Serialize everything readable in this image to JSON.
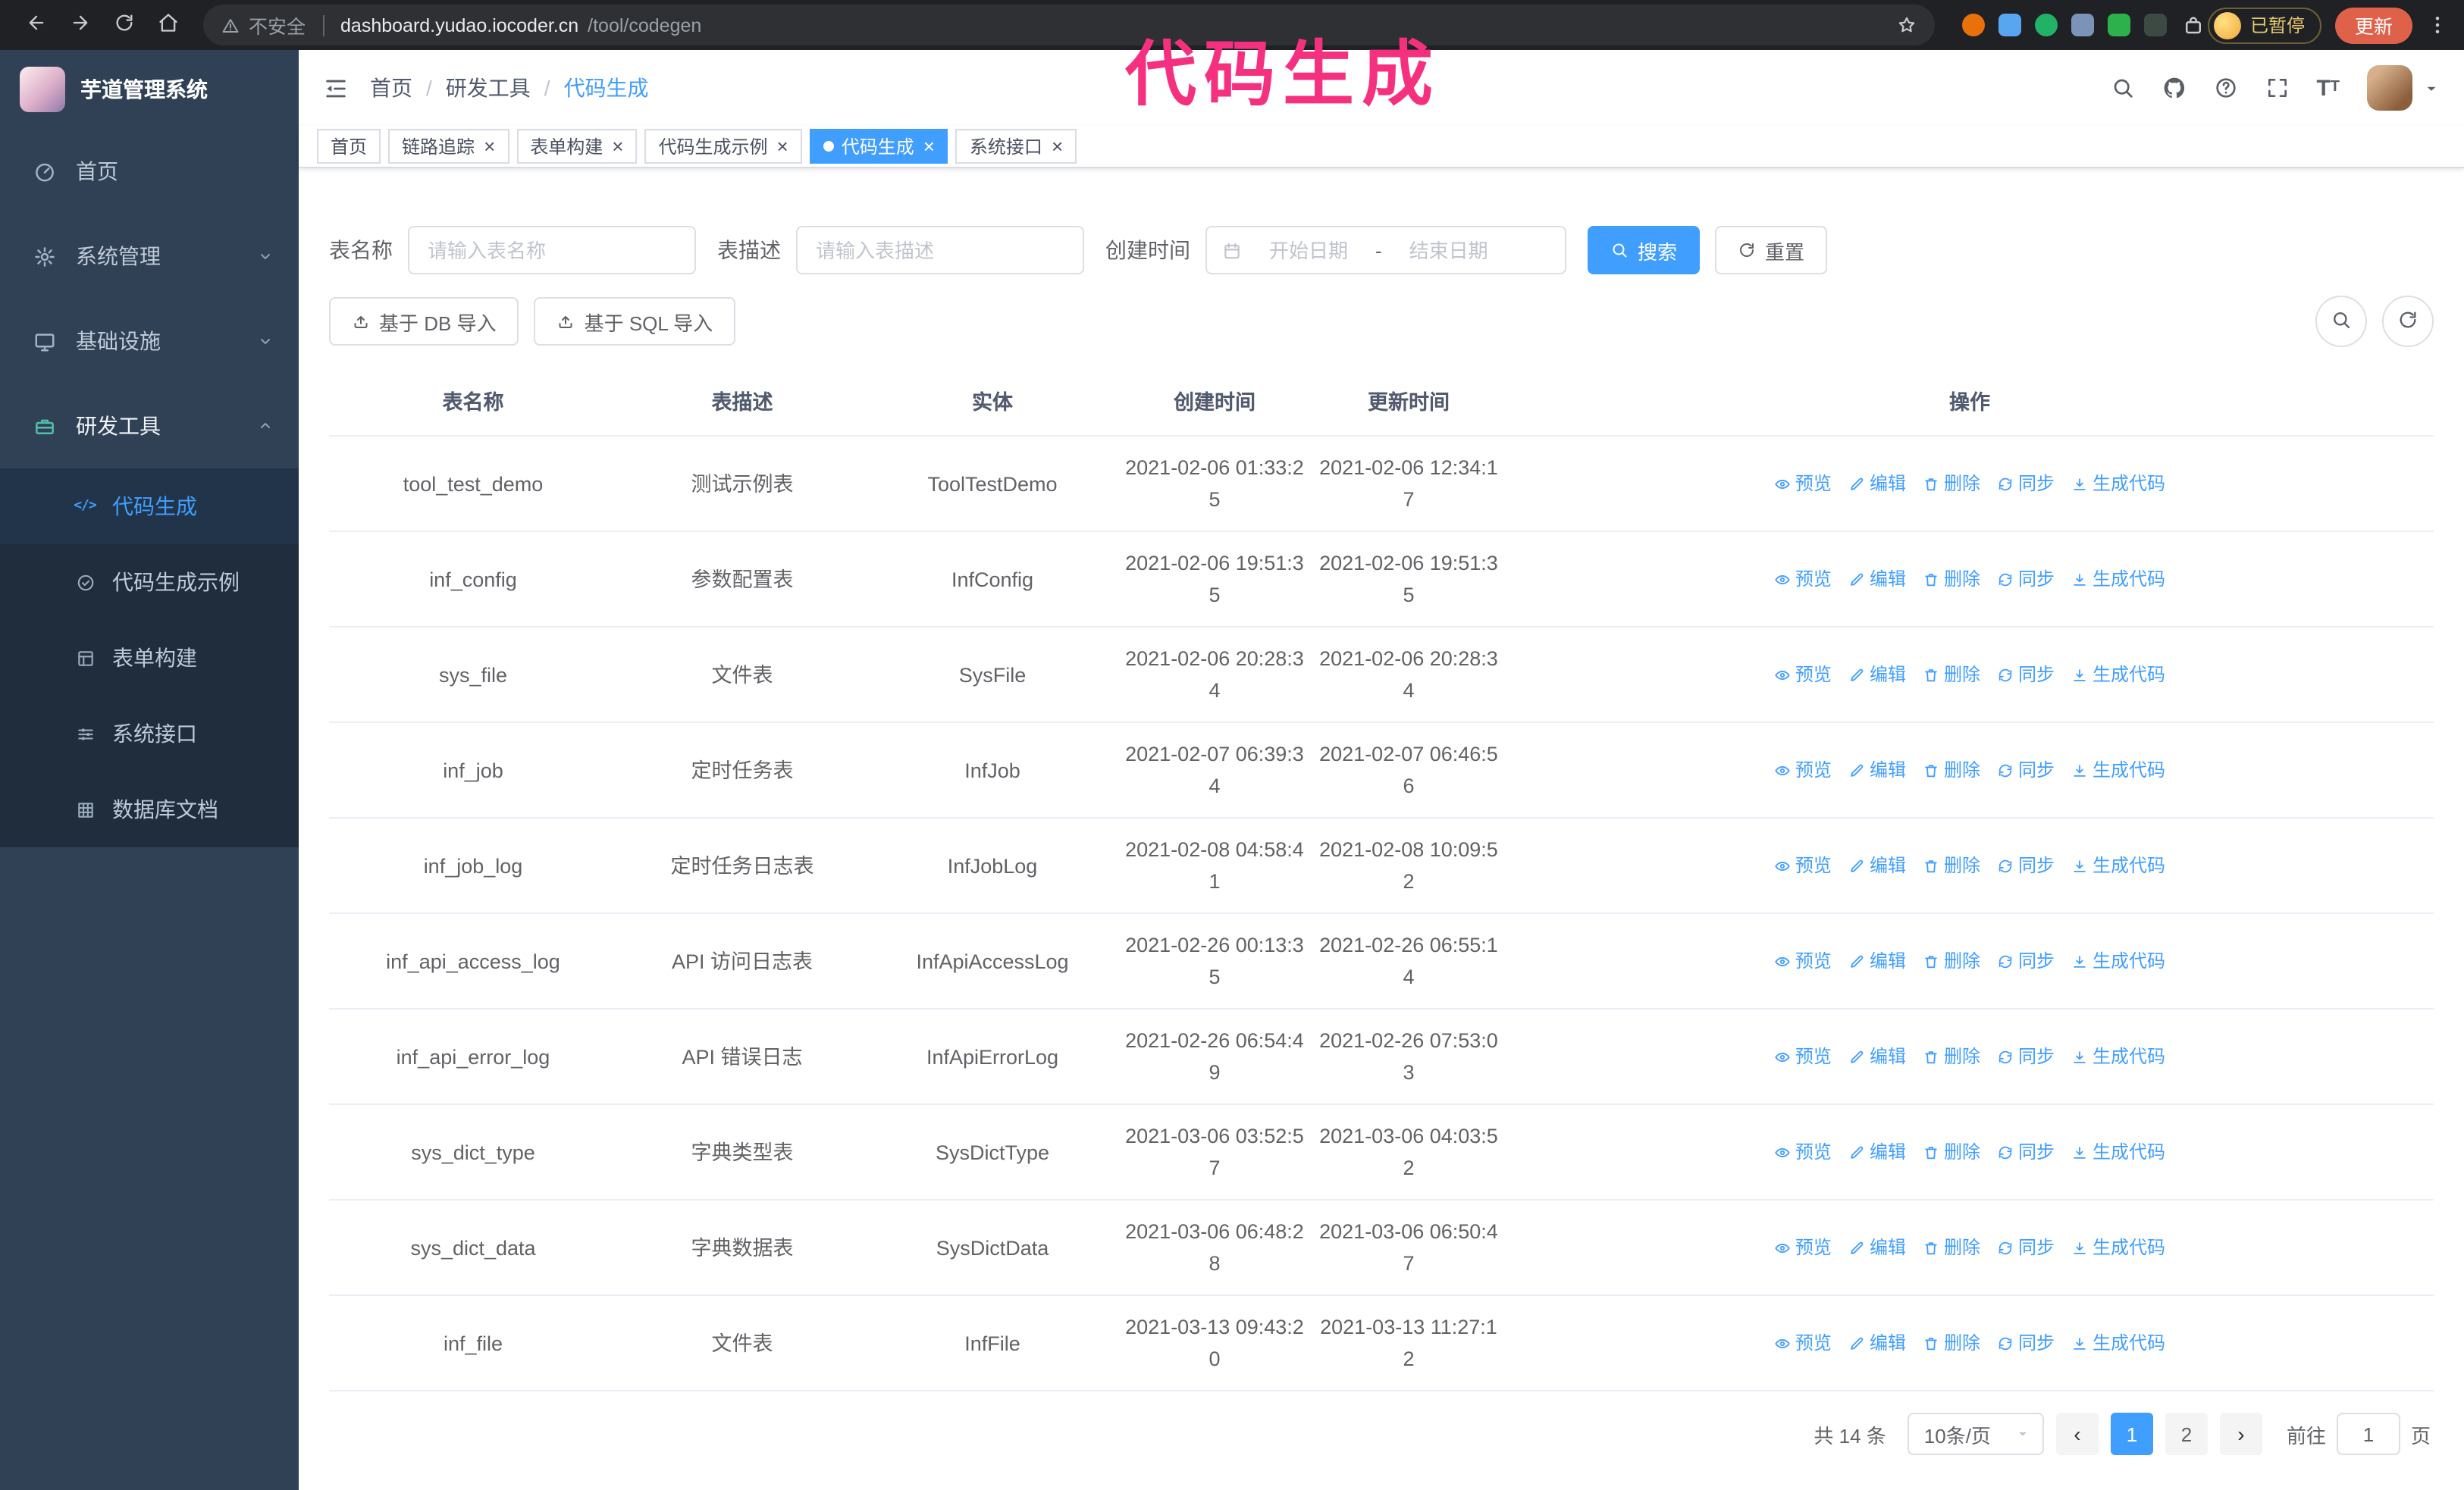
{
  "browser": {
    "security_label": "不安全",
    "url_host": "dashboard.yudao.iocoder.cn",
    "url_path": "/tool/codegen",
    "profile_badge": "已暂停",
    "update_button": "更新",
    "extension_colors": [
      "#e8710a",
      "#58a6f0",
      "#21b267",
      "#7a93b6",
      "#2bb24c",
      "#3d4a44"
    ]
  },
  "annotation": {
    "text": "代码生成",
    "color": "#f5317f"
  },
  "sidebar": {
    "logo_title": "芋道管理系统",
    "items": [
      {
        "label": "首页",
        "icon": "gauge"
      },
      {
        "label": "系统管理",
        "icon": "gear",
        "chevron": "down"
      },
      {
        "label": "基础设施",
        "icon": "monitor",
        "chevron": "down"
      },
      {
        "label": "研发工具",
        "icon": "toolbox",
        "chevron": "up",
        "expanded": true
      }
    ],
    "sub_items": [
      {
        "label": "代码生成",
        "icon": "code",
        "active": true
      },
      {
        "label": "代码生成示例",
        "icon": "badge-check",
        "active": false
      },
      {
        "label": "表单构建",
        "icon": "form-grid",
        "active": false
      },
      {
        "label": "系统接口",
        "icon": "sliders",
        "active": false
      },
      {
        "label": "数据库文档",
        "icon": "table-grid",
        "active": false
      }
    ]
  },
  "header": {
    "breadcrumb": [
      "首页",
      "研发工具",
      "代码生成"
    ]
  },
  "tabs": [
    {
      "label": "首页",
      "closable": false,
      "active": false
    },
    {
      "label": "链路追踪",
      "closable": true,
      "active": false
    },
    {
      "label": "表单构建",
      "closable": true,
      "active": false
    },
    {
      "label": "代码生成示例",
      "closable": true,
      "active": false
    },
    {
      "label": "代码生成",
      "closable": true,
      "active": true
    },
    {
      "label": "系统接口",
      "closable": true,
      "active": false
    }
  ],
  "filters": {
    "table_name_label": "表名称",
    "table_name_placeholder": "请输入表名称",
    "table_desc_label": "表描述",
    "table_desc_placeholder": "请输入表描述",
    "create_time_label": "创建时间",
    "start_date_placeholder": "开始日期",
    "end_date_placeholder": "结束日期",
    "date_separator": "-",
    "search_button": "搜索",
    "reset_button": "重置"
  },
  "toolbar": {
    "import_db": "基于 DB 导入",
    "import_sql": "基于 SQL 导入"
  },
  "table": {
    "columns": [
      "表名称",
      "表描述",
      "实体",
      "创建时间",
      "更新时间",
      "操作"
    ],
    "actions": [
      "预览",
      "编辑",
      "删除",
      "同步",
      "生成代码"
    ],
    "rows": [
      {
        "name": "tool_test_demo",
        "desc": "测试示例表",
        "entity": "ToolTestDemo",
        "created": "2021-02-06 01:33:25",
        "updated": "2021-02-06 12:34:17"
      },
      {
        "name": "inf_config",
        "desc": "参数配置表",
        "entity": "InfConfig",
        "created": "2021-02-06 19:51:35",
        "updated": "2021-02-06 19:51:35"
      },
      {
        "name": "sys_file",
        "desc": "文件表",
        "entity": "SysFile",
        "created": "2021-02-06 20:28:34",
        "updated": "2021-02-06 20:28:34"
      },
      {
        "name": "inf_job",
        "desc": "定时任务表",
        "entity": "InfJob",
        "created": "2021-02-07 06:39:34",
        "updated": "2021-02-07 06:46:56"
      },
      {
        "name": "inf_job_log",
        "desc": "定时任务日志表",
        "entity": "InfJobLog",
        "created": "2021-02-08 04:58:41",
        "updated": "2021-02-08 10:09:52"
      },
      {
        "name": "inf_api_access_log",
        "desc": "API 访问日志表",
        "entity": "InfApiAccessLog",
        "created": "2021-02-26 00:13:35",
        "updated": "2021-02-26 06:55:14"
      },
      {
        "name": "inf_api_error_log",
        "desc": "API 错误日志",
        "entity": "InfApiErrorLog",
        "created": "2021-02-26 06:54:49",
        "updated": "2021-02-26 07:53:03"
      },
      {
        "name": "sys_dict_type",
        "desc": "字典类型表",
        "entity": "SysDictType",
        "created": "2021-03-06 03:52:57",
        "updated": "2021-03-06 04:03:52"
      },
      {
        "name": "sys_dict_data",
        "desc": "字典数据表",
        "entity": "SysDictData",
        "created": "2021-03-06 06:48:28",
        "updated": "2021-03-06 06:50:47"
      },
      {
        "name": "inf_file",
        "desc": "文件表",
        "entity": "InfFile",
        "created": "2021-03-13 09:43:20",
        "updated": "2021-03-13 11:27:12"
      }
    ]
  },
  "pagination": {
    "total": "共 14 条",
    "page_size": "10条/页",
    "pages": [
      "1",
      "2"
    ],
    "active_page": "1",
    "goto_prefix": "前往",
    "goto_value": "1",
    "goto_suffix": "页"
  },
  "colors": {
    "primary": "#409eff",
    "sidebar_bg": "#304156",
    "submenu_bg": "#1f2d3d"
  }
}
